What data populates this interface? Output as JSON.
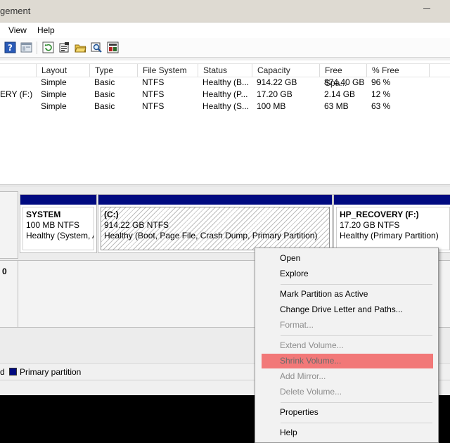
{
  "window": {
    "title": "gement"
  },
  "menu": {
    "items": [
      "View",
      "Help"
    ]
  },
  "toolbar": {
    "icons": [
      "help-icon",
      "console-icon",
      "refresh-icon",
      "properties-icon",
      "open-folder-icon",
      "search-icon",
      "settings-icon"
    ]
  },
  "volume_table": {
    "columns": [
      "Layout",
      "Type",
      "File System",
      "Status",
      "Capacity",
      "Free Spa...",
      "% Free"
    ],
    "rows": [
      {
        "volume": "",
        "layout": "Simple",
        "type": "Basic",
        "fs": "NTFS",
        "status": "Healthy (B...",
        "capacity": "914.22 GB",
        "free": "874.40 GB",
        "pct": "96 %"
      },
      {
        "volume": "ERY (F:)",
        "layout": "Simple",
        "type": "Basic",
        "fs": "NTFS",
        "status": "Healthy (P...",
        "capacity": "17.20 GB",
        "free": "2.14 GB",
        "pct": "12 %"
      },
      {
        "volume": "",
        "layout": "Simple",
        "type": "Basic",
        "fs": "NTFS",
        "status": "Healthy (S...",
        "capacity": "100 MB",
        "free": "63 MB",
        "pct": "63 %"
      }
    ]
  },
  "disk_view": {
    "disk1_label": "0",
    "partitions": [
      {
        "name": "SYSTEM",
        "size": "100 MB NTFS",
        "status": "Healthy (System, A"
      },
      {
        "name": "(C:)",
        "size": "914.22 GB NTFS",
        "status": "Healthy (Boot, Page File, Crash Dump, Primary Partition)"
      },
      {
        "name": "HP_RECOVERY  (F:)",
        "size": "17.20 GB NTFS",
        "status": "Healthy (Primary Partition)"
      }
    ]
  },
  "legend": {
    "prefix": "d",
    "primary": "Primary partition"
  },
  "context_menu": {
    "items": [
      {
        "label": "Open",
        "disabled": false
      },
      {
        "label": "Explore",
        "disabled": false
      },
      {
        "label": "Mark Partition as Active",
        "disabled": false
      },
      {
        "label": "Change Drive Letter and Paths...",
        "disabled": false
      },
      {
        "label": "Format...",
        "disabled": true
      },
      {
        "label": "Extend Volume...",
        "disabled": true
      },
      {
        "label": "Shrink Volume...",
        "disabled": false,
        "highlighted": true
      },
      {
        "label": "Add Mirror...",
        "disabled": true
      },
      {
        "label": "Delete Volume...",
        "disabled": true
      },
      {
        "label": "Properties",
        "disabled": false
      },
      {
        "label": "Help",
        "disabled": false
      }
    ]
  },
  "colors": {
    "partition_bar": "#000a80",
    "menu_highlight": "#f27878",
    "titlebar": "#dedad2"
  }
}
